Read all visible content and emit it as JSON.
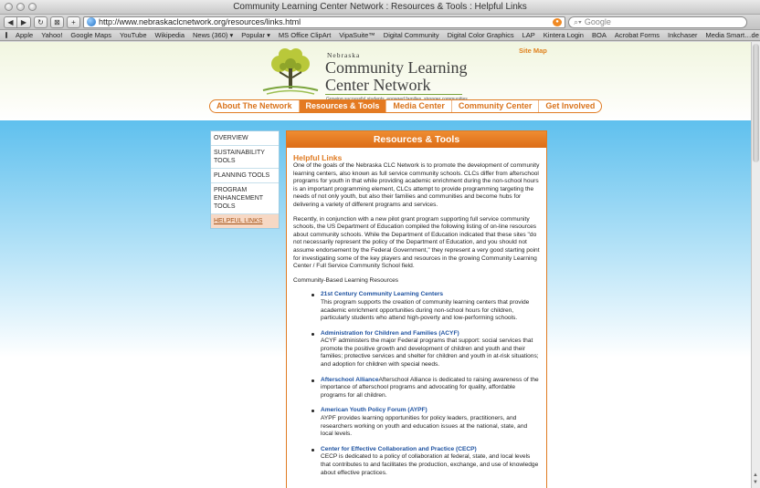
{
  "browser": {
    "window_title": "Community Learning Center Network : Resources & Tools : Helpful Links",
    "url": "http://www.nebraskaclcnetwork.org/resources/links.html",
    "search_placeholder": "Google",
    "bookmarks": [
      "Apple",
      "Yahoo!",
      "Google Maps",
      "YouTube",
      "Wikipedia",
      "News (360) ▾",
      "Popular ▾",
      "MS Office ClipArt",
      "VipaSuite™",
      "Digital Community",
      "Digital Color Graphics",
      "LAP",
      "Kintera Login",
      "BOA",
      "Acrobat Forms",
      "Inkchaser",
      "Media Smart…de Contents"
    ],
    "bookmark_overflow": "≫"
  },
  "header": {
    "logo_small": "Nebraska",
    "logo_line1": "Community Learning",
    "logo_line2": "Center Network",
    "tagline": "Growing successful students, engaged families, stronger communities",
    "site_map": "Site Map"
  },
  "nav": [
    "About The Network",
    "Resources & Tools",
    "Media Center",
    "Community Center",
    "Get Involved"
  ],
  "sidebar": [
    {
      "label": "Overview"
    },
    {
      "label": "Sustainability Tools"
    },
    {
      "label": "Planning Tools"
    },
    {
      "label": "Program Enhancement Tools"
    },
    {
      "label": "Helpful Links"
    }
  ],
  "content": {
    "heading": "Resources & Tools",
    "section_title": "Helpful Links",
    "para1": "One of the goals of the Nebraska CLC Network is to promote the development of community learning centers, also known as full service community schools. CLCs differ from afterschool programs for youth in that while providing academic enrichment during the non-school hours is an important programming element, CLCs attempt to provide programming targeting the needs of not only youth, but also their families and communities and become hubs for delivering a variety of different programs and services.",
    "para2": "Recently, in conjunction with a new pilot grant program supporting full service community schools, the US Department of Education compiled the following listing of on-line resources about community schools. While the Department of Education indicated that these sites \"do not necessarily represent the policy of the Department of Education, and you should not assume endorsement by the Federal Government,\" they represent a very good starting point for investigating some of the key players and resources in the growing Community Learning Center / Full Service Community School field.",
    "list_heading": "Community-Based Learning Resources",
    "resources": [
      {
        "name": "21st Century Community Learning Centers",
        "desc": "This program supports the creation of community learning centers that provide academic enrichment opportunities during non-school hours for children, particularly students who attend high-poverty and low-performing schools."
      },
      {
        "name": "Administration for Children and Families (ACYF)",
        "desc": "ACYF administers the major Federal programs that support: social services that promote the positive growth and development of children and youth and their families; protective services and shelter for children and youth in at-risk situations; and adoption for children with special needs."
      },
      {
        "name": "Afterschool Alliance",
        "desc": "Afterschool Alliance is dedicated to raising awareness of the importance of afterschool programs and advocating for quality, affordable programs for all children."
      },
      {
        "name": "American Youth Policy Forum (AYPF)",
        "desc": "AYPF provides learning opportunities for policy leaders, practitioners, and researchers working on youth and education issues at the national, state, and local levels."
      },
      {
        "name": "Center for Effective Collaboration and Practice (CECP)",
        "desc": "CECP is dedicated to a policy of collaboration at federal, state, and local levels that contributes to and facilitates the production, exchange, and use of knowledge about effective practices."
      }
    ]
  },
  "colors": {
    "accent_orange": "#e07b22",
    "link_blue": "#1e52a0",
    "sky_blue": "#5fc0ee"
  }
}
